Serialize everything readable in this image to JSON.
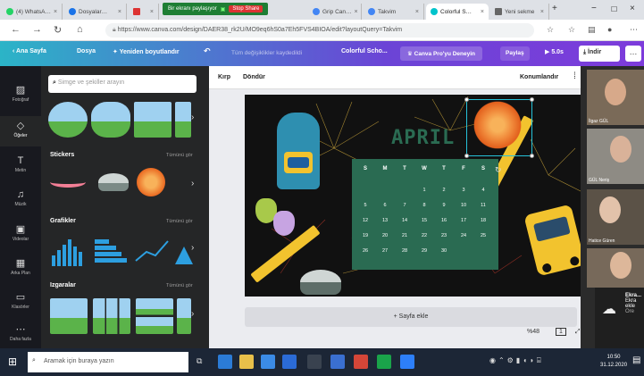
{
  "browser": {
    "tabs": [
      {
        "label": "(4) WhatsA…",
        "color": "#25d366"
      },
      {
        "label": "Dosyalar…",
        "color": "#1a73e8"
      },
      {
        "label": "",
        "color": "#d33"
      },
      {
        "label": "Grip Can…",
        "color": "#4285f4"
      },
      {
        "label": "Takvim",
        "color": "#4285f4"
      },
      {
        "label": "Colorful S…",
        "color": "#00c4cc"
      },
      {
        "label": "Yeni sekme",
        "color": "#666"
      }
    ],
    "share_notice": "Bir ekranı paylaşıyor",
    "share_stop": "Stop Share",
    "url": "https://www.canva.com/design/DAER38_rk2U/MO9eq6hS0a7Eh5FVS4BIOA/edit?layoutQuery=Takvim"
  },
  "canva_toolbar": {
    "home": "Ana Sayfa",
    "file": "Dosya",
    "resize": "Yeniden boyutlandır",
    "saved_text": "Tüm değişiklikler kaydedildi",
    "doc_title": "Colorful Scho...",
    "try_pro": "Canva Pro'yu Deneyin",
    "share": "Paylaş",
    "duration": "5.0s",
    "download": "İndir",
    "more": "…"
  },
  "sidebar": {
    "items": [
      {
        "label": "Fotoğraf",
        "icon": "image-icon"
      },
      {
        "label": "Öğeler",
        "icon": "shapes-icon",
        "active": true
      },
      {
        "label": "Metin",
        "icon": "text-icon"
      },
      {
        "label": "Müzik",
        "icon": "music-icon"
      },
      {
        "label": "Videolar",
        "icon": "video-icon"
      },
      {
        "label": "Arka Plan",
        "icon": "background-icon"
      },
      {
        "label": "Klasörler",
        "icon": "folder-icon"
      },
      {
        "label": "Daha fazla",
        "icon": "more-icon"
      }
    ]
  },
  "panel": {
    "search_placeholder": "Simge ve şekiller arayın",
    "sections": [
      {
        "title": "Stickers",
        "see_all": "Tümünü gör"
      },
      {
        "title": "Grafikler",
        "see_all": "Tümünü gör"
      },
      {
        "title": "Izgaralar",
        "see_all": "Tümünü gör"
      }
    ]
  },
  "canvas_toolbar": {
    "crop": "Kırp",
    "flip": "Döndür",
    "position": "Konumlandır"
  },
  "design": {
    "month_title": "APRIL",
    "weekdays": [
      "S",
      "M",
      "T",
      "W",
      "T",
      "F",
      "S"
    ],
    "weeks": [
      [
        "",
        "",
        "",
        "1",
        "2",
        "3",
        "4"
      ],
      [
        "5",
        "6",
        "7",
        "8",
        "9",
        "10",
        "11"
      ],
      [
        "12",
        "13",
        "14",
        "15",
        "16",
        "17",
        "18"
      ],
      [
        "19",
        "20",
        "21",
        "22",
        "23",
        "24",
        "25"
      ],
      [
        "26",
        "27",
        "28",
        "29",
        "30",
        "",
        ""
      ]
    ],
    "background": "#111111",
    "calendar_color": "#2a6b52",
    "selection_color": "#26c2d9"
  },
  "add_page": "+ Sayfa ekle",
  "zoom": "%48",
  "video": {
    "participants": [
      "İlgaz GÜL",
      "GÜL Neriş",
      "Hatice Güren"
    ],
    "notification": {
      "title": "Ekra...",
      "line1": "Ekra",
      "line2": "ekle",
      "line3": "Ore"
    }
  },
  "taskbar": {
    "search": "Aramak için buraya yazın",
    "time": "10:50",
    "date": "31.12.2020"
  }
}
